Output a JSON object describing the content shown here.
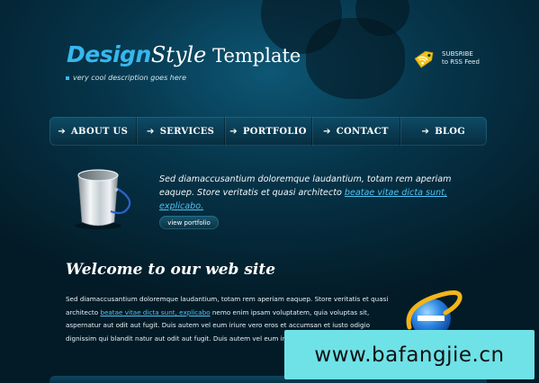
{
  "logo": {
    "design": "Design",
    "style": "Style",
    "template": " Template"
  },
  "tagline": "very cool description goes here",
  "rss": {
    "line1": "SUBSRIBE",
    "line2": "to RSS Feed"
  },
  "nav": [
    {
      "label": "ABOUT US"
    },
    {
      "label": "SERVICES"
    },
    {
      "label": "PORTFOLIO"
    },
    {
      "label": "CONTACT"
    },
    {
      "label": "BLOG"
    }
  ],
  "intro": {
    "text": "Sed diamaccusantium doloremque laudantium, totam rem aperiam eaquep. Store veritatis et quasi architecto ",
    "link": "beatae vitae dicta sunt, explicabo.",
    "button": "view portfolio"
  },
  "welcome": {
    "title": "Welcome to our web site",
    "text_before_link": "Sed diamaccusantium doloremque laudantium, totam rem aperiam eaquep. Store veritatis et quasi architecto ",
    "link": "beatae vitae dicta sunt, explicabo",
    "text_after_link": " nemo enim ipsam voluptatem, quia voluptas sit, aspernatur aut odit aut fugit. Duis autem vel eum iriure vero eros et accumsan et iusto odigio dignissim qui blandit natur aut odit aut fugit. Duis autem vel eum iriure vero eros et accumsan."
  },
  "watermark": "www.bafangjie.cn",
  "colors": {
    "accent": "#37b7ee",
    "link": "#4ec3f3",
    "background": "#063449",
    "watermark_bg": "#6ee2e7"
  },
  "icons": {
    "rss": "rss-tag-icon",
    "bucket": "bucket-icon",
    "browser": "internet-explorer-icon",
    "nav_arrow": "arrow-right-icon"
  }
}
